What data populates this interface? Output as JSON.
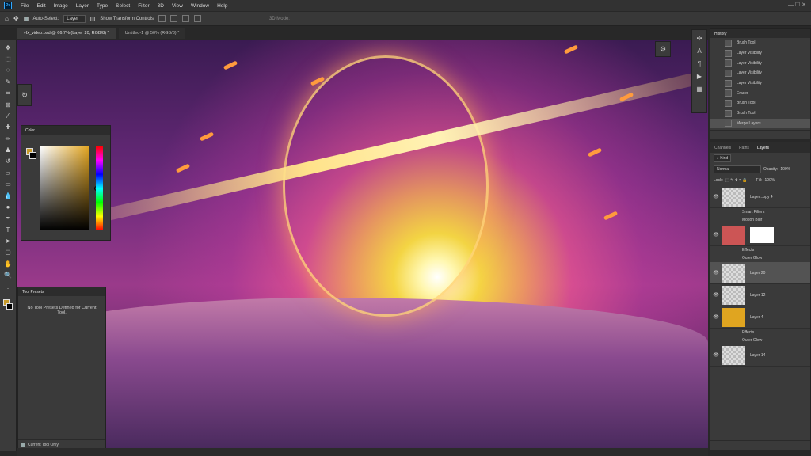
{
  "menubar": {
    "logo": "Ps",
    "items": [
      "File",
      "Edit",
      "Image",
      "Layer",
      "Type",
      "Select",
      "Filter",
      "3D",
      "View",
      "Window",
      "Help"
    ]
  },
  "options": {
    "auto_select_label": "Auto-Select:",
    "auto_select_value": "Layer",
    "transform_label": "Show Transform Controls",
    "mode_label": "3D Mode:"
  },
  "tabs": [
    {
      "label": "vfx_video.psd @ 66.7% (Layer 20, RGB/8) *"
    },
    {
      "label": "Untitled-1 @ 50% (RGB/8) *"
    }
  ],
  "color_panel": {
    "title": "Color",
    "fg_color": "#c79b2a",
    "bg_color": "#000000"
  },
  "presets": {
    "title": "Tool Presets",
    "message": "No Tool Presets Defined for Current Tool.",
    "current_only": "Current Tool Only"
  },
  "history": {
    "title": "History",
    "items": [
      "Brush Tool",
      "Layer Visibility",
      "Layer Visibility",
      "Layer Visibility",
      "Layer Visibility",
      "Eraser",
      "Brush Tool",
      "Brush Tool",
      "Merge Layers"
    ],
    "selected_index": 8
  },
  "layers_panel": {
    "tabs": [
      "Channels",
      "Paths",
      "Layers"
    ],
    "active_tab": "Layers",
    "kind_label": "Kind",
    "blend_mode": "Normal",
    "opacity_label": "Opacity:",
    "opacity_value": "100%",
    "lock_label": "Lock:",
    "fill_label": "Fill:",
    "fill_value": "100%",
    "layers": [
      {
        "name": "Layer...opy 4",
        "subs": [
          "Smart Filters",
          "Motion Blur"
        ]
      },
      {
        "name": "",
        "subs": [
          "Effects",
          "Outer Glow"
        ]
      },
      {
        "name": "Layer 20",
        "subs": []
      },
      {
        "name": "Layer 12",
        "subs": []
      },
      {
        "name": "Layer 4",
        "subs": [
          "Effects",
          "Outer Glow"
        ]
      },
      {
        "name": "Layer 14",
        "subs": []
      }
    ],
    "selected_layer": "Layer 20"
  }
}
